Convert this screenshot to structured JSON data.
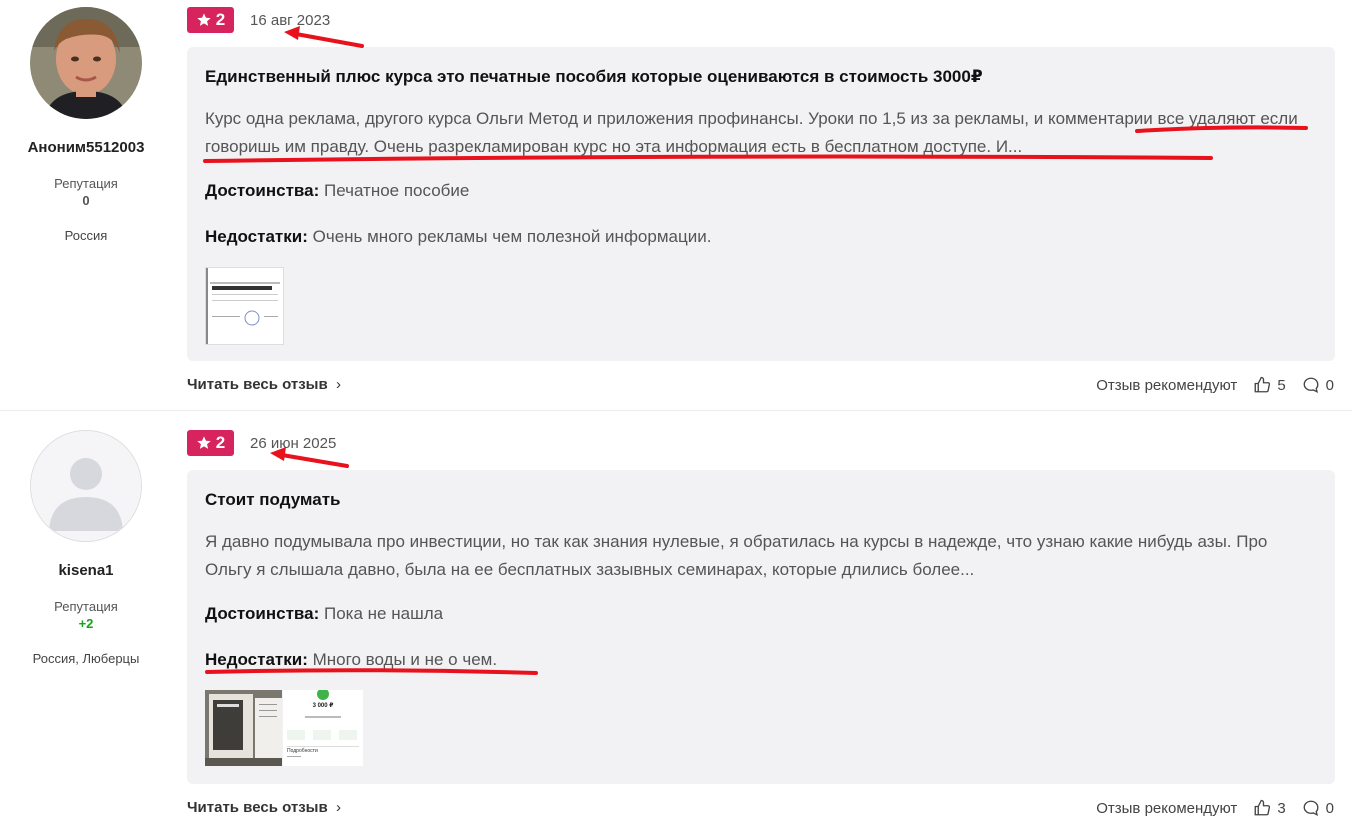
{
  "reviews": [
    {
      "author": {
        "name": "Аноним5512003",
        "reputation_label": "Репутация",
        "reputation": "0",
        "location": "Россия"
      },
      "rating": "2",
      "date": "16 авг 2023",
      "title": "Единственный плюс курса это печатные пособия которые оцениваются в стоимость 3000₽",
      "body": "Курс одна реклама, другого курса Ольги Метод и приложения профинансы. Уроки по 1,5 из за рекламы, и комментарии все удаляют если говоришь им правду. Очень разрекламирован курс но эта информация есть в бесплатном доступе. И...",
      "pros_label": "Достоинства:",
      "pros": "Печатное пособие",
      "cons_label": "Недостатки:",
      "cons": "Очень много рекламы чем полезной информации.",
      "read_more": "Читать весь отзыв",
      "recommend_label": "Отзыв рекомендуют",
      "likes": "5",
      "comments": "0"
    },
    {
      "author": {
        "name": "kisena1",
        "reputation_label": "Репутация",
        "reputation": "+2",
        "location": "Россия, Люберцы"
      },
      "rating": "2",
      "date": "26 июн 2025",
      "title": "Стоит подумать",
      "body": "Я давно подумывала про инвестиции, но так как знания нулевые, я обратилась на курсы в надежде, что узнаю какие нибудь азы. Про Ольгу я слышала давно, была на ее бесплатных зазывных семинарах, которые длились более...",
      "pros_label": "Достоинства:",
      "pros": "Пока не нашла",
      "cons_label": "Недостатки:",
      "cons": "Много воды и не о чем.",
      "read_more": "Читать весь отзыв",
      "recommend_label": "Отзыв рекомендуют",
      "likes": "3",
      "comments": "0",
      "thumb_price": "3 000 ₽",
      "thumb_section": "Подробности"
    }
  ],
  "colors": {
    "badge": "#d7245e",
    "card": "#f2f2f4",
    "annotation": "#e8121c",
    "positive": "#19a11b"
  },
  "icons": [
    "star-icon",
    "thumbs-up-icon",
    "comment-icon",
    "chevron-right-icon",
    "avatar-placeholder-icon"
  ]
}
